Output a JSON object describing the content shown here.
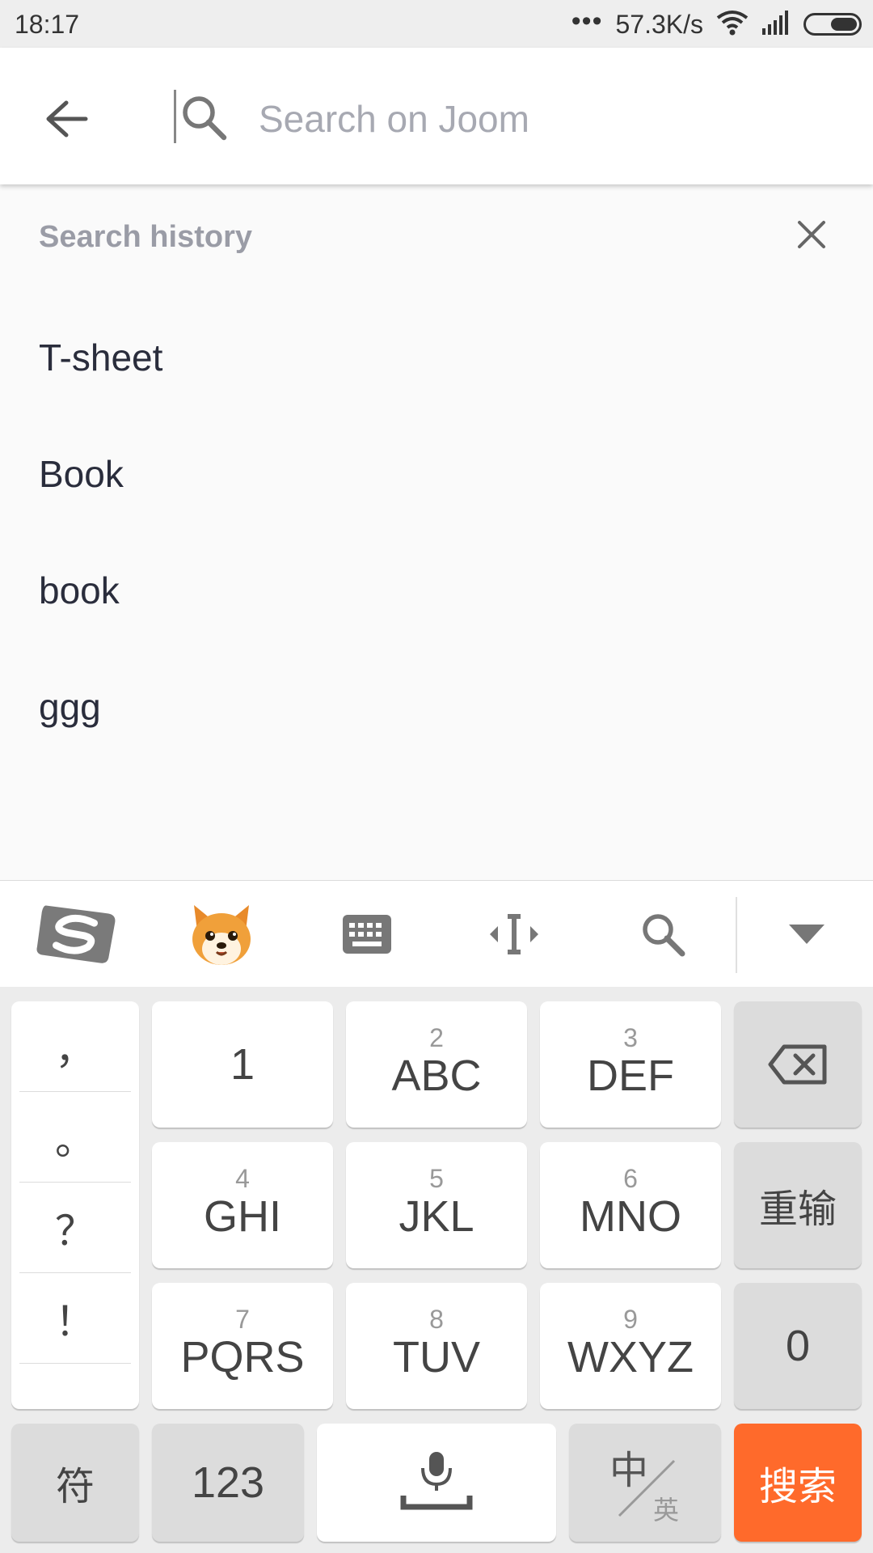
{
  "status_bar": {
    "time": "18:17",
    "dots": "•••",
    "speed": "57.3K/s"
  },
  "search": {
    "placeholder": "Search on Joom",
    "value": ""
  },
  "history": {
    "title": "Search history",
    "items": [
      "T-sheet",
      "Book",
      "book",
      "ggg"
    ]
  },
  "keyboard": {
    "toolbar": [
      "sogou-logo",
      "emoji-fox",
      "keyboard-icon",
      "cursor-move-icon",
      "search-icon",
      "collapse-icon"
    ],
    "punctuation": [
      "，",
      "。",
      "？",
      "！"
    ],
    "keys": {
      "k1": {
        "num": "",
        "letters": "1"
      },
      "k2": {
        "num": "2",
        "letters": "ABC"
      },
      "k3": {
        "num": "3",
        "letters": "DEF"
      },
      "k4": {
        "num": "4",
        "letters": "GHI"
      },
      "k5": {
        "num": "5",
        "letters": "JKL"
      },
      "k6": {
        "num": "6",
        "letters": "MNO"
      },
      "k7": {
        "num": "7",
        "letters": "PQRS"
      },
      "k8": {
        "num": "8",
        "letters": "TUV"
      },
      "k9": {
        "num": "9",
        "letters": "WXYZ"
      }
    },
    "reenter": "重输",
    "zero": "0",
    "symbols": "符",
    "numbers": "123",
    "lang_main": "中",
    "lang_sub": "英",
    "search_key": "搜索"
  },
  "colors": {
    "accent": "#ff6a2b",
    "history_text": "#2a2d3c",
    "muted": "#9a9ca6"
  }
}
